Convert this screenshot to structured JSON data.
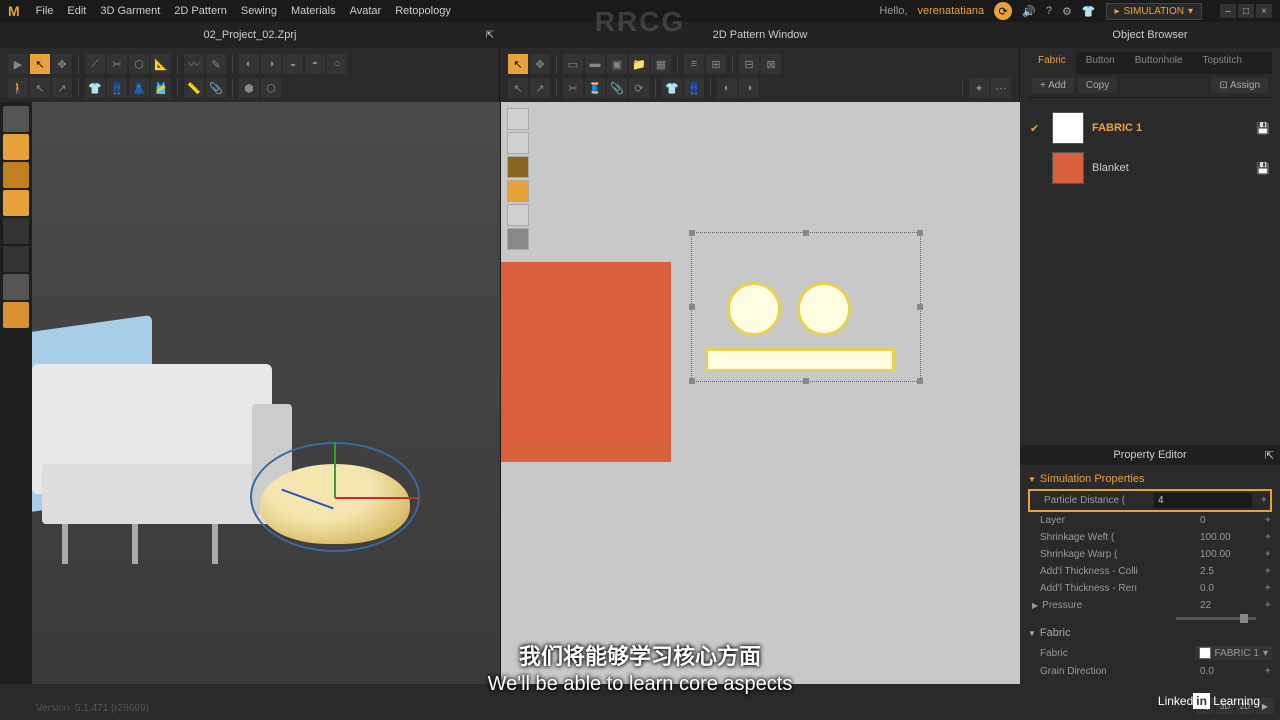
{
  "app": {
    "logo": "M"
  },
  "menu": [
    "File",
    "Edit",
    "3D Garment",
    "2D Pattern",
    "Sewing",
    "Materials",
    "Avatar",
    "Retopology"
  ],
  "topright": {
    "hello": "Hello,",
    "user": "verenatatiana",
    "mode": "SIMULATION"
  },
  "tabs": {
    "left": "02_Project_02.Zprj",
    "mid": "2D Pattern Window",
    "right": "Object Browser"
  },
  "fabric_tabs": [
    "Fabric",
    "Button",
    "Buttonhole",
    "Topstitch"
  ],
  "buttons": {
    "add": "+  Add",
    "copy": "Copy",
    "assign": "Assign"
  },
  "fabrics": [
    {
      "name": "FABRIC 1",
      "color": "#ffffff",
      "checked": true
    },
    {
      "name": "Blanket",
      "color": "#d8603c",
      "checked": false
    }
  ],
  "prop_editor": "Property Editor",
  "sections": {
    "sim": "Simulation Properties",
    "fabric": "Fabric"
  },
  "props": {
    "particle": {
      "label": "Particle Distance (",
      "value": "4"
    },
    "layer": {
      "label": "Layer",
      "value": "0"
    },
    "weft": {
      "label": "Shrinkage Weft (",
      "value": "100.00"
    },
    "warp": {
      "label": "Shrinkage Warp (",
      "value": "100.00"
    },
    "thick_c": {
      "label": "Add'l Thickness - Colli",
      "value": "2.5"
    },
    "thick_r": {
      "label": "Add'l Thickness - Ren",
      "value": "0.0"
    },
    "pressure": {
      "label": "Pressure",
      "value": "22"
    },
    "fabric": {
      "label": "Fabric",
      "value": "FABRIC 1"
    },
    "grain": {
      "label": "Grain Direction",
      "value": "0.0"
    }
  },
  "subtitle": {
    "cn": "我们将能够学习核心方面",
    "en": "We'll be able to learn core aspects"
  },
  "version": "Version: 5.1.471 (r28699)",
  "watermark": "RRCG",
  "linkedin": {
    "pre": "Linked",
    "in": "in",
    "post": "Learning"
  }
}
